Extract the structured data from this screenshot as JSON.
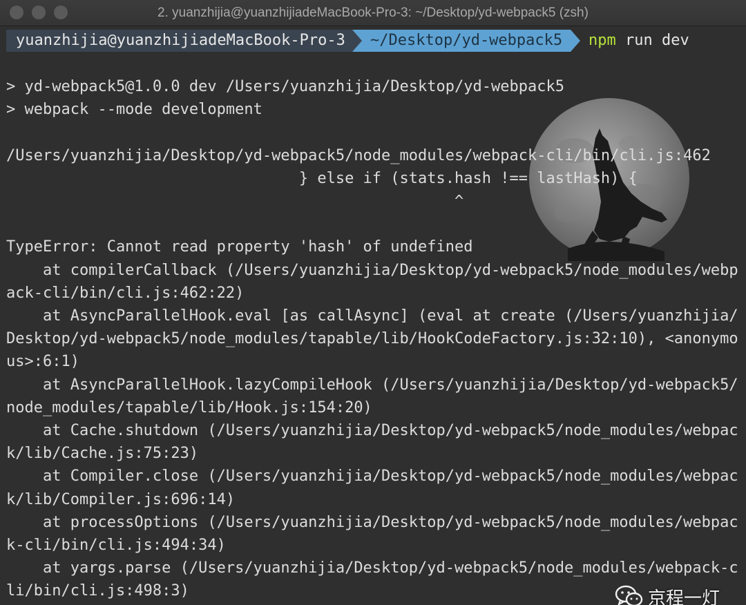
{
  "window": {
    "title": "2. yuanzhijia@yuanzhijiadeMacBook-Pro-3: ~/Desktop/yd-webpack5 (zsh)"
  },
  "prompt": {
    "user_host": "yuanzhijia@yuanzhijiadeMacBook-Pro-3",
    "directory": "~/Desktop/yd-webpack5",
    "command_name": "npm",
    "command_args": " run dev"
  },
  "output_lines": [
    "> yd-webpack5@1.0.0 dev /Users/yuanzhijia/Desktop/yd-webpack5",
    "> webpack --mode development",
    "",
    "/Users/yuanzhijia/Desktop/yd-webpack5/node_modules/webpack-cli/bin/cli.js:462",
    "                                } else if (stats.hash !== lastHash) {",
    "                                                 ^",
    "",
    "TypeError: Cannot read property 'hash' of undefined",
    "    at compilerCallback (/Users/yuanzhijia/Desktop/yd-webpack5/node_modules/webp",
    "ack-cli/bin/cli.js:462:22)",
    "    at AsyncParallelHook.eval [as callAsync] (eval at create (/Users/yuanzhijia/",
    "Desktop/yd-webpack5/node_modules/tapable/lib/HookCodeFactory.js:32:10), <anonymo",
    "us>:6:1)",
    "    at AsyncParallelHook.lazyCompileHook (/Users/yuanzhijia/Desktop/yd-webpack5/",
    "node_modules/tapable/lib/Hook.js:154:20)",
    "    at Cache.shutdown (/Users/yuanzhijia/Desktop/yd-webpack5/node_modules/webpac",
    "k/lib/Cache.js:75:23)",
    "    at Compiler.close (/Users/yuanzhijia/Desktop/yd-webpack5/node_modules/webpac",
    "k/lib/Compiler.js:696:14)",
    "    at processOptions (/Users/yuanzhijia/Desktop/yd-webpack5/node_modules/webpac",
    "k-cli/bin/cli.js:494:34)",
    "    at yargs.parse (/Users/yuanzhijia/Desktop/yd-webpack5/node_modules/webpack-c",
    "li/bin/cli.js:498:3)"
  ],
  "watermark": {
    "text": "京程一灯",
    "icon": "wechat-icon"
  },
  "colors": {
    "background": "#2f2f2f",
    "text": "#dcdcdc",
    "prompt_user_bg": "#3a4450",
    "prompt_dir_bg": "#5ea2d3",
    "command_green": "#b8e33a"
  }
}
